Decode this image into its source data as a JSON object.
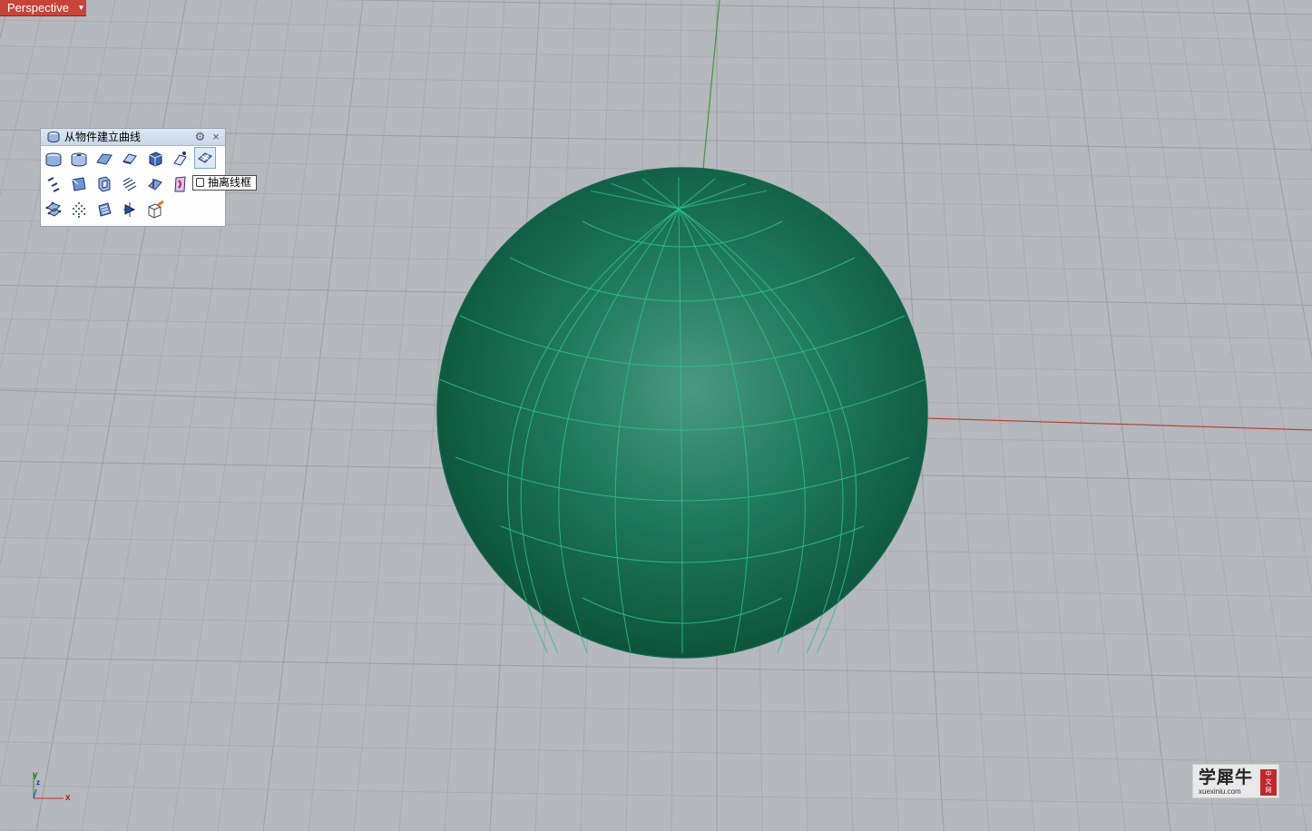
{
  "viewport": {
    "name": "Perspective",
    "menu_arrow": "▼",
    "colors": {
      "background": "#b5b8bc",
      "grid_minor": "#a7aaae",
      "grid_major": "#9a9da1",
      "x_axis": "#b8453b",
      "y_axis": "#3c9a3c",
      "sphere_fill": "#1f7a5c",
      "sphere_wire": "#2fc08a",
      "label_bg": "#c8443a"
    }
  },
  "toolbar": {
    "title": "从物件建立曲线",
    "title_icon": "curve-from-object-icon",
    "settings_icon": "gear-icon",
    "close_icon": "close-icon",
    "close_glyph": "×",
    "settings_glyph": "⚙",
    "rows": [
      [
        "project-curve-icon",
        "pull-curve-icon",
        "duplicate-edge-icon",
        "duplicate-border-icon",
        "duplicate-face-border-icon",
        "silhouette-icon",
        "extract-wireframe-icon"
      ],
      [
        "extract-isocurve-icon",
        "extract-curvature-icon",
        "contour-icon",
        "section-icon",
        "intersect-icon",
        "unroll-icon"
      ],
      [
        "extract-points-icon",
        "point-cloud-icon",
        "create-uv-curves-icon",
        "mesh-outline-icon",
        "box-edges-icon"
      ]
    ]
  },
  "tooltip": {
    "text": "抽离线框"
  },
  "axis_indicator": {
    "x": "x",
    "y": "y",
    "z": "z"
  },
  "watermark": {
    "name": "学犀牛",
    "url": "xuexiniu.com",
    "seal_line1": "中",
    "seal_line2": "文",
    "seal_line3": "网"
  }
}
